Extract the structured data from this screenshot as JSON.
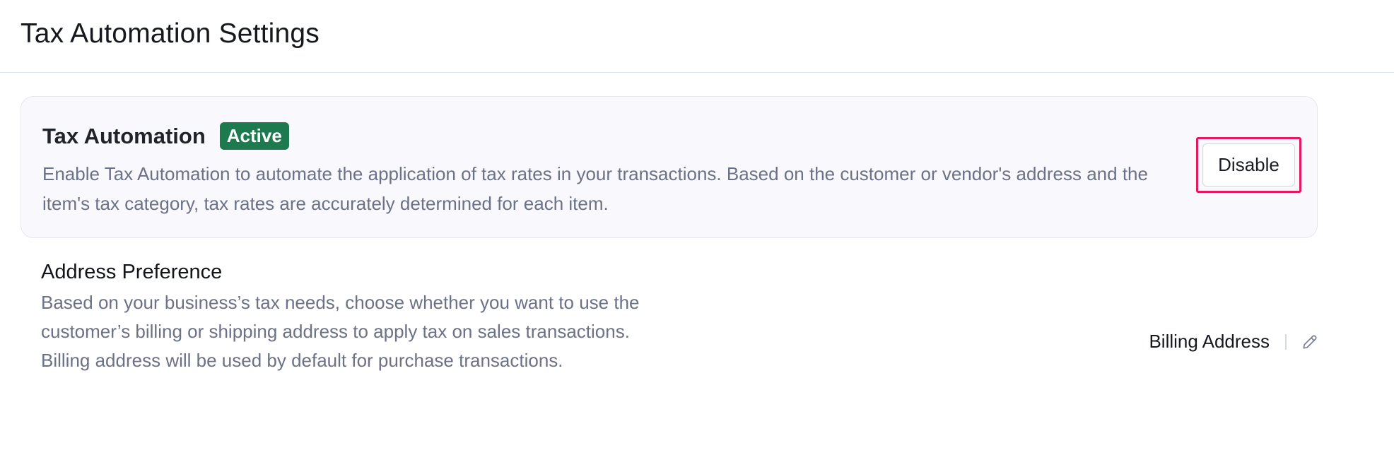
{
  "page": {
    "title": "Tax Automation Settings"
  },
  "tax_automation": {
    "title": "Tax Automation",
    "status": "Active",
    "status_color": "#1d7a4f",
    "description": "Enable Tax Automation to automate the application of tax rates in your transactions. Based on the customer or vendor's address and the item's tax category, tax rates are accurately determined for each item.",
    "disable_label": "Disable",
    "highlight_color": "#e5195f"
  },
  "address_preference": {
    "title": "Address Preference",
    "description": "Based on your business’s tax needs, choose whether you want to use the customer’s billing or shipping address to apply tax on sales transactions. Billing address will be used by default for purchase transactions.",
    "value": "Billing Address",
    "edit_icon": "pencil-icon"
  }
}
